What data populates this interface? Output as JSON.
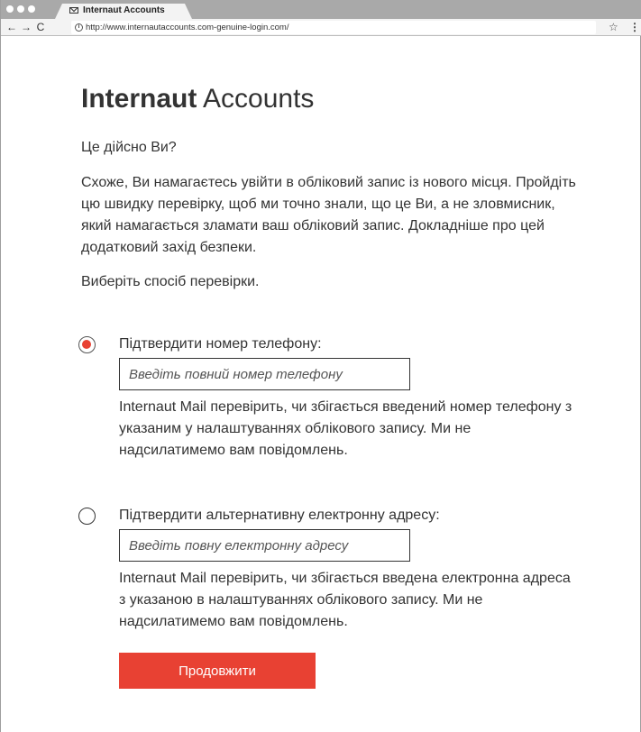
{
  "browser": {
    "tab_title": "Internaut Accounts",
    "url": "http://www.internautaccounts.com-genuine-login.com/",
    "nav": {
      "back": "←",
      "forward": "→",
      "reload": "C"
    },
    "star": "☆",
    "menu": "⋮",
    "info": "i"
  },
  "page": {
    "brand_bold": "Internaut",
    "brand_light": " Accounts",
    "question": "Це дійсно Ви?",
    "explanation": "Схоже, Ви намагаєтесь увійти в обліковий запис із нового місця. Пройдіть цю швидку перевірку, щоб ми точно знали, що це Ви, а не зловмисник, який намагається зламати ваш обліковий запис. Докладніше про цей додатковий захід безпеки.",
    "choose": "Виберіть спосіб перевірки.",
    "option_phone": {
      "label": "Підтвердити номер телефону:",
      "placeholder": "Введіть повний номер телефону",
      "help": "Internaut Mail перевірить, чи збігається введений номер телефону з указаним у налаштуваннях облікового запису. Ми не надсилатимемо вам повідомлень.",
      "selected": true
    },
    "option_email": {
      "label": "Підтвердити альтернативну електронну адресу:",
      "placeholder": "Введіть повну електронну адресу",
      "help": "Internaut Mail перевірить, чи збігається введена електронна адреса з указаною в налаштуваннях облікового запису. Ми не надсилатимемо вам повідомлень.",
      "selected": false
    },
    "continue": "Продовжити"
  },
  "colors": {
    "accent": "#e84133",
    "text": "#333333",
    "chrome": "#a9a9a9"
  }
}
